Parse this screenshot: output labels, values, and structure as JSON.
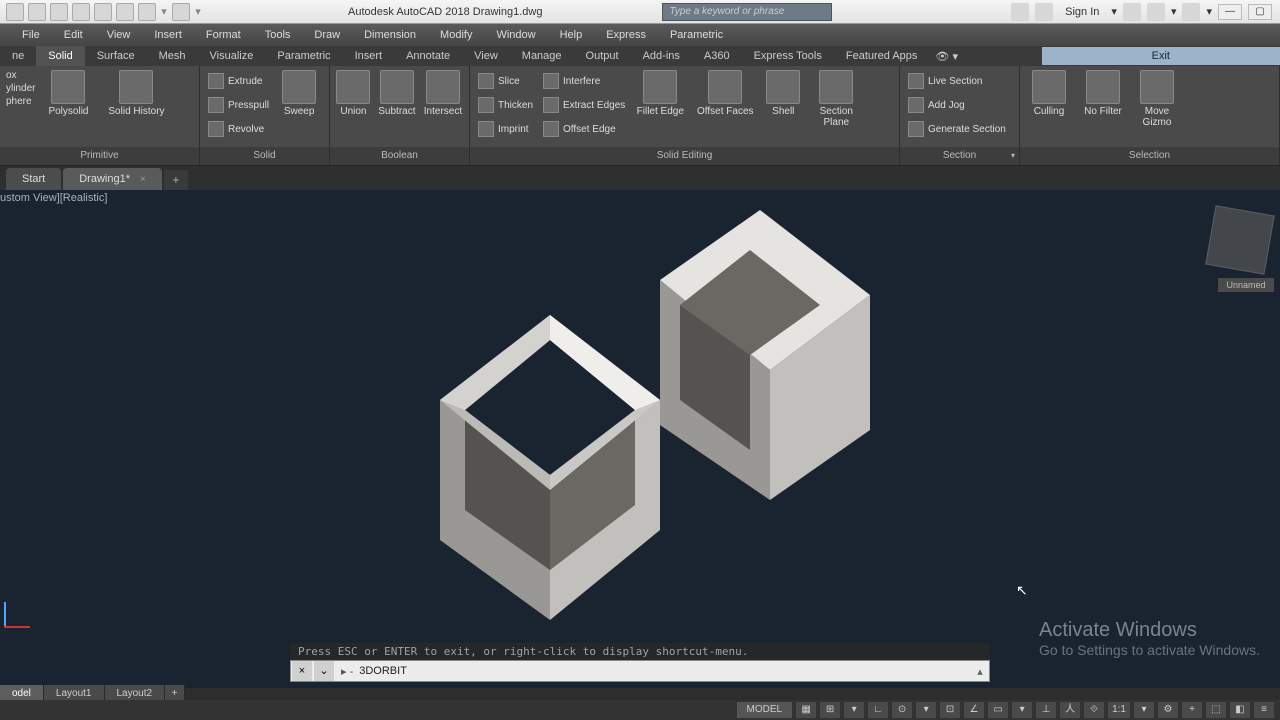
{
  "title": "Autodesk AutoCAD 2018   Drawing1.dwg",
  "search_placeholder": "Type a keyword or phrase",
  "signin": "Sign In",
  "menubar": [
    "File",
    "Edit",
    "View",
    "Insert",
    "Format",
    "Tools",
    "Draw",
    "Dimension",
    "Modify",
    "Window",
    "Help",
    "Express",
    "Parametric"
  ],
  "ribtabs": [
    "ne",
    "Solid",
    "Surface",
    "Mesh",
    "Visualize",
    "Parametric",
    "Insert",
    "Annotate",
    "View",
    "Manage",
    "Output",
    "Add-ins",
    "A360",
    "Express Tools",
    "Featured Apps"
  ],
  "ribtabs_active": 1,
  "exit_label": "Exit",
  "ribbon": {
    "primitive": {
      "title": "Primitive",
      "left": [
        "ox",
        "ylinder",
        "phere"
      ],
      "polysolid": "Polysolid",
      "solidhistory": "Solid History"
    },
    "solid": {
      "title": "Solid",
      "list": [
        "Extrude",
        "Presspull",
        "Revolve"
      ],
      "sweep": "Sweep"
    },
    "boolean": {
      "title": "Boolean",
      "union": "Union",
      "subtract": "Subtract",
      "intersect": "Intersect"
    },
    "solidediting": {
      "title": "Solid Editing",
      "col1": [
        "Slice",
        "Thicken",
        "Imprint"
      ],
      "col2": [
        "Interfere",
        "Extract Edges",
        "Offset Edge"
      ],
      "fillet": "Fillet Edge",
      "offsetfaces": "Offset Faces",
      "shell": "Shell",
      "sectionplane": "Section\nPlane"
    },
    "section": {
      "title": "Section",
      "live": "Live Section",
      "addjog": "Add Jog",
      "generate": "Generate Section"
    },
    "selection": {
      "title": "Selection",
      "culling": "Culling",
      "nofilter": "No Filter",
      "movegizmo": "Move\nGizmo"
    }
  },
  "filetabs": {
    "start": "Start",
    "drawing": "Drawing1*"
  },
  "viewport": {
    "label": "ustom View][Realistic]",
    "viewcube_label": "Unnamed"
  },
  "watermark": {
    "line1": "Activate Windows",
    "line2": "Go to Settings to activate Windows."
  },
  "command": {
    "hint": "Press ESC or ENTER to exit, or right-click to display shortcut-menu.",
    "prompt": "▸ -",
    "text": "3DORBIT"
  },
  "layout_tabs": [
    "odel",
    "Layout1",
    "Layout2"
  ],
  "statusbar": {
    "model": "MODEL",
    "scale": "1:1"
  }
}
